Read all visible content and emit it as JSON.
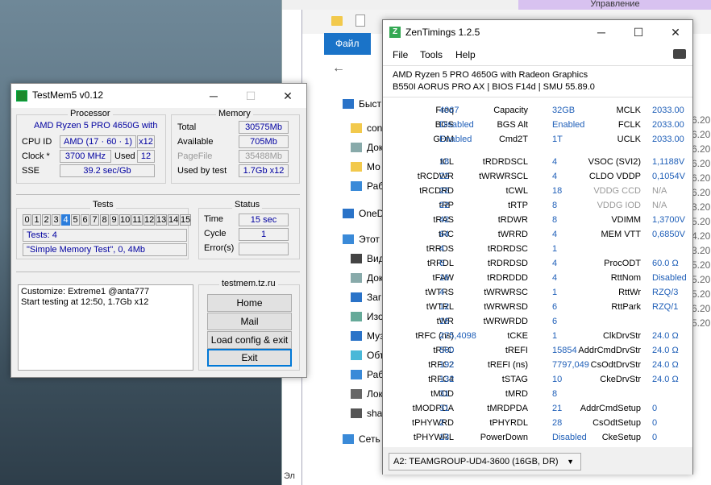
{
  "background": {
    "ribbon_tab": "Управление",
    "file_tab": "Файл",
    "tree": [
      {
        "label": "Быст",
        "icon": "star-icon"
      },
      {
        "label": "con",
        "icon": "folder-icon"
      },
      {
        "label": "Док",
        "icon": "document-icon"
      },
      {
        "label": "Мо",
        "icon": "folder-icon"
      },
      {
        "label": "Раб",
        "icon": "desktop-icon"
      },
      {
        "label": "OneD",
        "icon": "cloud-icon"
      },
      {
        "label": "Этот",
        "icon": "computer-icon"
      },
      {
        "label": "Вид",
        "icon": "video-icon"
      },
      {
        "label": "Док",
        "icon": "document-icon"
      },
      {
        "label": "Заг",
        "icon": "download-icon"
      },
      {
        "label": "Изо",
        "icon": "image-icon"
      },
      {
        "label": "Муз",
        "icon": "music-icon"
      },
      {
        "label": "Объ",
        "icon": "cube-icon"
      },
      {
        "label": "Раб",
        "icon": "desktop-icon"
      },
      {
        "label": "Лок",
        "icon": "drive-icon"
      },
      {
        "label": "sha",
        "icon": "network-drive-icon"
      },
      {
        "label": "Сеть",
        "icon": "network-icon"
      }
    ],
    "bottom_text": "Эл",
    "right_dates": [
      "6.20",
      "6.20",
      "6.20",
      "6.20",
      "6.20",
      "6.20",
      "3.20",
      "5.20",
      "4.20",
      "3.20",
      "5.20",
      "5.20",
      "5.20",
      "6.20",
      "5.20"
    ]
  },
  "testmem": {
    "title": "TestMem5 v0.12",
    "processor": {
      "group": "Processor",
      "name": "AMD Ryzen 5 PRO 4650G with",
      "cpuid_label": "CPU ID",
      "cpuid_value": "AMD  (17 · 60 · 1)",
      "threads": "x12",
      "clock_label": "Clock *",
      "clock_value": "3700 MHz",
      "used_label": "Used",
      "used_value": "12",
      "sse_label": "SSE",
      "sse_value": "39.2 sec/Gb"
    },
    "memory": {
      "group": "Memory",
      "total_label": "Total",
      "total_value": "30575Mb",
      "available_label": "Available",
      "available_value": "705Mb",
      "pagefile_label": "PageFile",
      "pagefile_value": "35488Mb",
      "usedby_label": "Used by test",
      "usedby_value": "1.7Gb x12"
    },
    "tests": {
      "group": "Tests",
      "numbers": [
        "0",
        "1",
        "2",
        "3",
        "4",
        "5",
        "6",
        "7",
        "8",
        "9",
        "10",
        "11",
        "12",
        "13",
        "14",
        "15"
      ],
      "active": "4",
      "count_text": "Tests: 4",
      "current_text": "\"Simple Memory Test\", 0, 4Mb"
    },
    "status": {
      "group": "Status",
      "time_label": "Time",
      "time_value": "15 sec",
      "cycle_label": "Cycle",
      "cycle_value": "1",
      "errors_label": "Error(s)",
      "errors_value": ""
    },
    "log": [
      "Customize: Extreme1 @anta777",
      "Start testing at 12:50, 1.7Gb x12"
    ],
    "site": "testmem.tz.ru",
    "buttons": {
      "home": "Home",
      "mail": "Mail",
      "load": "Load config & exit",
      "exit": "Exit"
    }
  },
  "zen": {
    "title": "ZenTimings 1.2.5",
    "menu": [
      "File",
      "Tools",
      "Help"
    ],
    "cpu": "AMD Ryzen 5 PRO 4650G with Radeon Graphics",
    "board": "B550I AORUS PRO AX | BIOS F14d | SMU 55.89.0",
    "top": [
      [
        "Freq",
        "4067",
        "Capacity",
        "32GB",
        "MCLK",
        "2033.00"
      ],
      [
        "BGS",
        "Disabled",
        "BGS Alt",
        "Enabled",
        "FCLK",
        "2033.00"
      ],
      [
        "GDM",
        "Enabled",
        "Cmd2T",
        "1T",
        "UCLK",
        "2033.00"
      ]
    ],
    "rows": [
      [
        "tCL",
        "18",
        "tRDRDSCL",
        "4",
        "VSOC (SVI2)",
        "1,1188V"
      ],
      [
        "tRCDWR",
        "22",
        "tWRWRSCL",
        "4",
        "CLDO VDDP",
        "0,1054V"
      ],
      [
        "tRCDRD",
        "22",
        "tCWL",
        "18",
        "VDDG CCD",
        "N/A"
      ],
      [
        "tRP",
        "22",
        "tRTP",
        "8",
        "VDDG IOD",
        "N/A"
      ],
      [
        "tRAS",
        "42",
        "tRDWR",
        "8",
        "VDIMM",
        "1,3700V"
      ],
      [
        "tRC",
        "64",
        "tWRRD",
        "4",
        "MEM VTT",
        "0,6850V"
      ],
      [
        "tRRDS",
        "4",
        "tRDRDSC",
        "1",
        "",
        ""
      ],
      [
        "tRRDL",
        "6",
        "tRDRDSD",
        "4",
        "ProcODT",
        "60.0 Ω"
      ],
      [
        "tFAW",
        "16",
        "tRDRDDD",
        "4",
        "RttNom",
        "Disabled"
      ],
      [
        "tWTRS",
        "4",
        "tWRWRSC",
        "1",
        "RttWr",
        "RZQ/3"
      ],
      [
        "tWTRL",
        "12",
        "tWRWRSD",
        "6",
        "RttPark",
        "RZQ/1"
      ],
      [
        "tWR",
        "16",
        "tWRWRDD",
        "6",
        "",
        ""
      ],
      [
        "tRFC (ns)",
        "275,4098",
        "tCKE",
        "1",
        "ClkDrvStr",
        "24.0 Ω"
      ],
      [
        "tRFC",
        "560",
        "tREFI",
        "15854",
        "AddrCmdDrvStr",
        "24.0 Ω"
      ],
      [
        "tRFC2",
        "192",
        "tREFI (ns)",
        "7797,049",
        "CsOdtDrvStr",
        "24.0 Ω"
      ],
      [
        "tRFC4",
        "132",
        "tSTAG",
        "10",
        "CkeDrvStr",
        "24.0 Ω"
      ],
      [
        "tMOD",
        "31",
        "tMRD",
        "8",
        "",
        ""
      ],
      [
        "tMODPDA",
        "31",
        "tMRDPDA",
        "21",
        "AddrCmdSetup",
        "0"
      ],
      [
        "tPHYWRD",
        "2",
        "tPHYRDL",
        "28",
        "CsOdtSetup",
        "0"
      ],
      [
        "tPHYWRL",
        "13",
        "PowerDown",
        "Disabled",
        "CkeSetup",
        "0"
      ]
    ],
    "gray_rows": [
      2,
      3
    ],
    "module": "A2: TEAMGROUP-UD4-3600 (16GB, DR)"
  }
}
